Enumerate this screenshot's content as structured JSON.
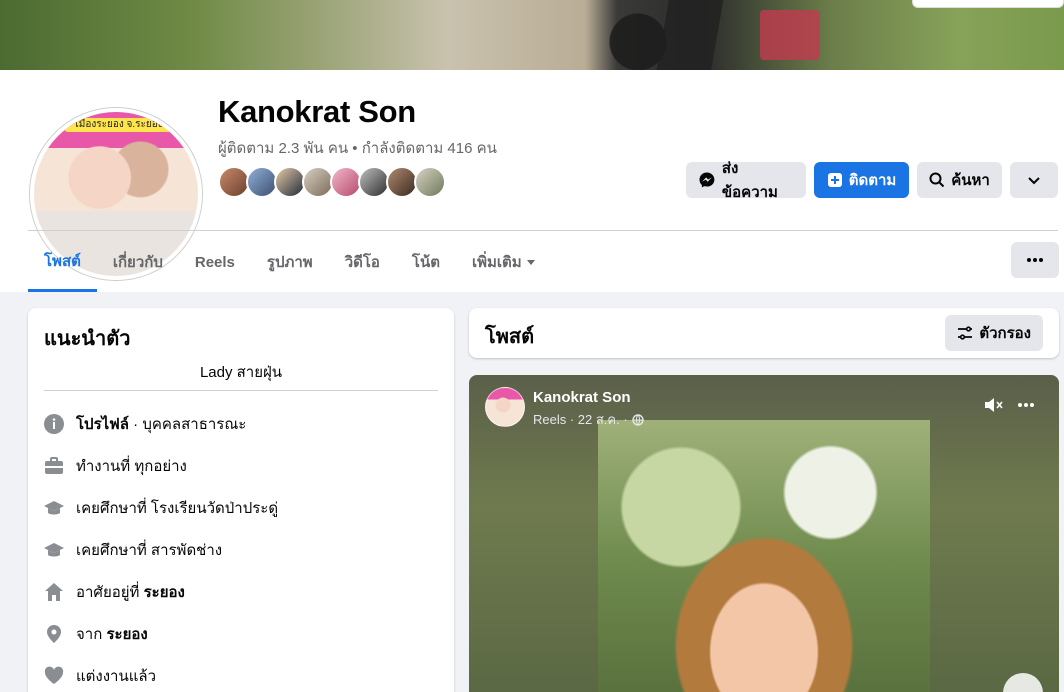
{
  "profile": {
    "name": "Kanokrat Son",
    "stats": "ผู้ติดตาม 2.3 พัน คน • กำลังติดตาม 416 คน",
    "avatar_banner": "เมืองระยอง จ.ระยอง"
  },
  "actions": {
    "message": "ส่งข้อความ",
    "follow": "ติดตาม",
    "search": "ค้นหา"
  },
  "tabs": [
    {
      "label": "โพสต์"
    },
    {
      "label": "เกี่ยวกับ"
    },
    {
      "label": "Reels"
    },
    {
      "label": "รูปภาพ"
    },
    {
      "label": "วิดีโอ"
    },
    {
      "label": "โน้ต"
    },
    {
      "label": "เพิ่มเติม"
    }
  ],
  "intro": {
    "title": "แนะนำตัว",
    "bio": "Lady สายฝุ่น",
    "items": [
      {
        "icon": "info-icon",
        "bold": "โปรไฟล์",
        "text": " · บุคคลสาธารณะ"
      },
      {
        "icon": "briefcase-icon",
        "bold": "",
        "text": "ทำงานที่ ทุกอย่าง"
      },
      {
        "icon": "graduation-cap-icon",
        "bold": "",
        "text": "เคยศึกษาที่ โรงเรียนวัดป่าประดู่"
      },
      {
        "icon": "graduation-cap-icon",
        "bold": "",
        "text": "เคยศึกษาที่ สารพัดช่าง"
      },
      {
        "icon": "home-icon",
        "pre": "อาศัยอยู่ที่ ",
        "bold": "ระยอง"
      },
      {
        "icon": "location-pin-icon",
        "pre": "จาก ",
        "bold": "ระยอง"
      },
      {
        "icon": "heart-icon",
        "bold": "",
        "text": "แต่งงานแล้ว"
      }
    ]
  },
  "posts": {
    "title": "โพสต์",
    "filter_label": "ตัวกรอง",
    "post": {
      "author": "Kanokrat Son",
      "meta": "Reels · 22 ส.ค. ·"
    }
  },
  "colors": {
    "accent": "#1b74e4",
    "background": "#f0f2f5"
  }
}
